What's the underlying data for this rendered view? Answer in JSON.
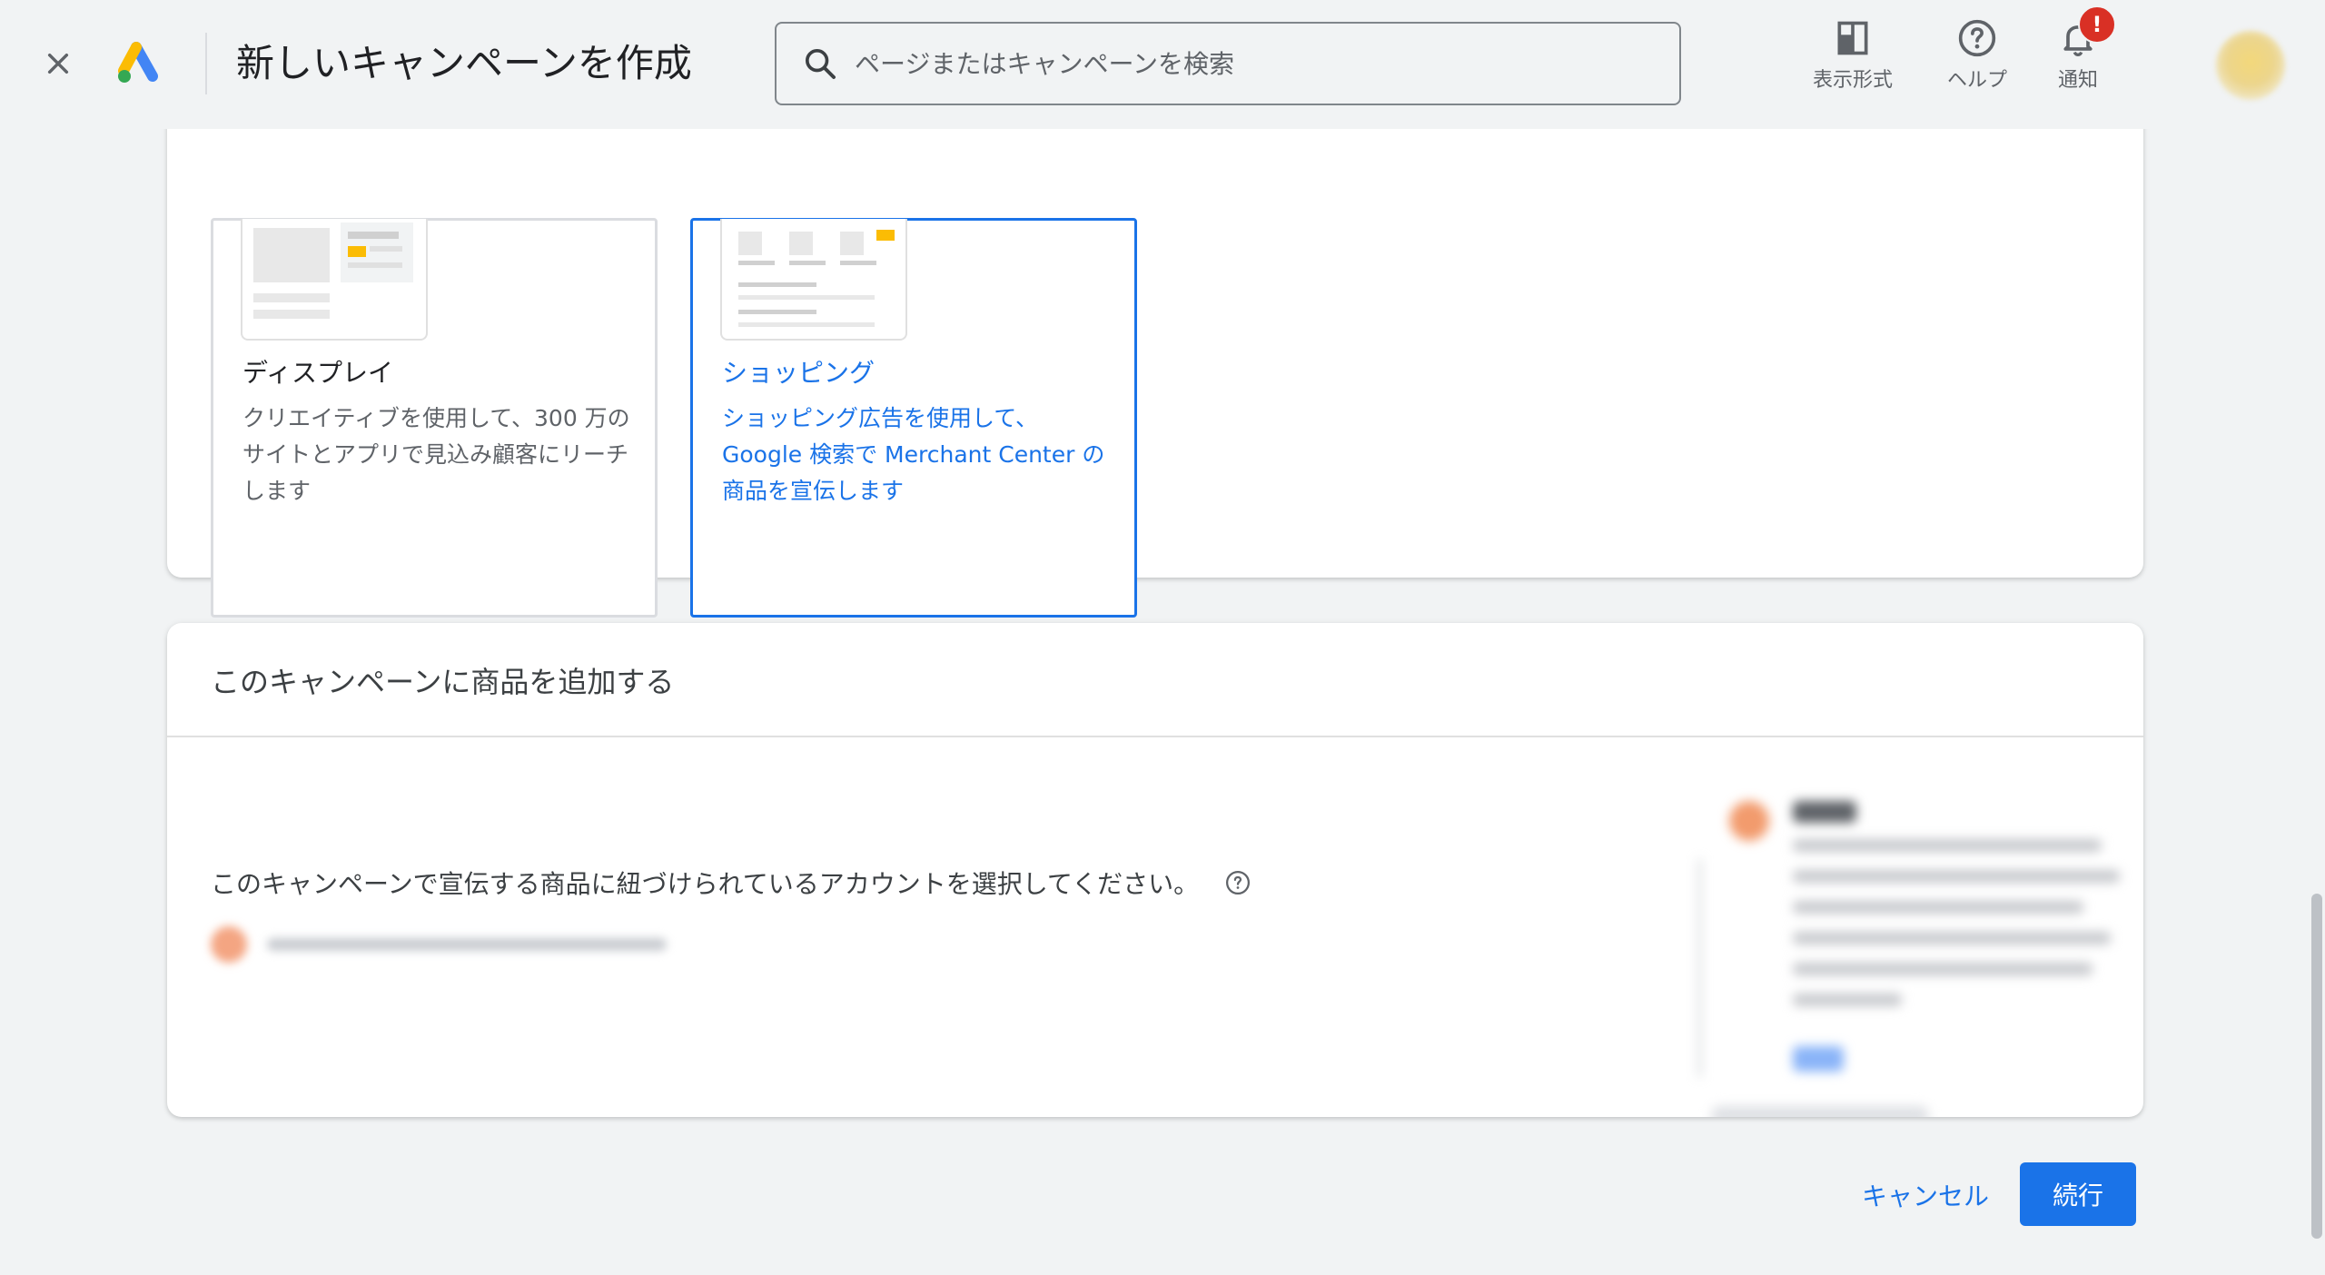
{
  "header": {
    "title": "新しいキャンペーンを作成",
    "search_placeholder": "ページまたはキャンペーンを検索",
    "actions": [
      {
        "label": "表示形式",
        "icon": "layout-icon"
      },
      {
        "label": "ヘルプ",
        "icon": "help-icon"
      },
      {
        "label": "通知",
        "icon": "bell-icon",
        "badge": "!"
      }
    ]
  },
  "campaign_types": [
    {
      "name": "ディスプレイ",
      "description": "クリエイティブを使用して、300 万のサイトとアプリで見込み顧客にリーチします",
      "selected": false
    },
    {
      "name": "ショッピング",
      "description": "ショッピング広告を使用して、Google 検索で Merchant Center の商品を宣伝します",
      "selected": true
    }
  ],
  "products_section": {
    "title": "このキャンペーンに商品を追加する",
    "instruction": "このキャンペーンで宣伝する商品に紐づけられているアカウントを選択してください。"
  },
  "footer": {
    "cancel_label": "キャンセル",
    "continue_label": "続行"
  },
  "colors": {
    "accent": "#1a73e8",
    "badge": "#d93025",
    "background": "#f1f3f4"
  }
}
